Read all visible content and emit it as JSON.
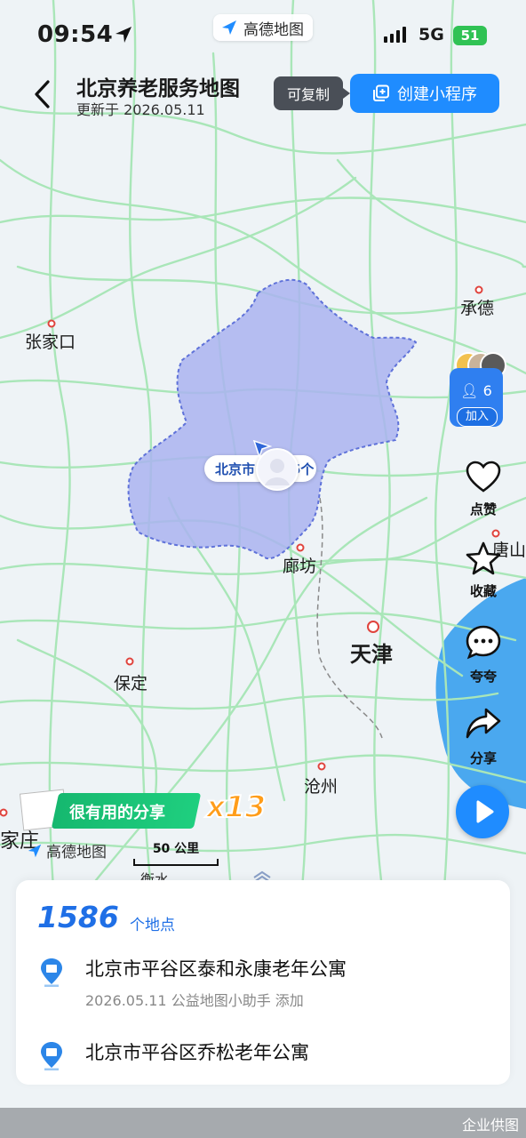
{
  "status_bar": {
    "time": "09:54",
    "network": "5G",
    "battery": "51"
  },
  "app_badge": {
    "label": "高德地图"
  },
  "header": {
    "title": "北京养老服务地图",
    "updated": "更新于 2026.05.11",
    "copy_tip": "可复制",
    "create_button": "创建小程序"
  },
  "map": {
    "city_labels": [
      "张家口",
      "承德",
      "廊坊",
      "天津",
      "保定",
      "沧州",
      "唐山",
      "家庄",
      "衡水"
    ],
    "region_marker": {
      "label_left": "北京市",
      "label_right": "5个"
    },
    "region_color": "#aab3f0",
    "road_color": "#a9e6b8"
  },
  "members": {
    "count": "6",
    "join": "加入"
  },
  "actions": [
    {
      "label": "点赞",
      "icon": "heart-icon"
    },
    {
      "label": "收藏",
      "icon": "star-icon"
    },
    {
      "label": "夸夸",
      "icon": "chat-icon"
    },
    {
      "label": "分享",
      "icon": "share-icon"
    }
  ],
  "share_badge": {
    "text": "很有用的分享",
    "multiplier": "x13"
  },
  "brand": {
    "label": "高德地图"
  },
  "scale": {
    "label": "50 公里"
  },
  "summary": {
    "count": "1586",
    "unit": "个地点"
  },
  "places": [
    {
      "name": "北京市平谷区泰和永康老年公寓",
      "meta": "2026.05.11 公益地图小助手 添加"
    },
    {
      "name": "北京市平谷区乔松老年公寓",
      "meta": ""
    }
  ],
  "footer": {
    "watermark": "企业供图"
  }
}
